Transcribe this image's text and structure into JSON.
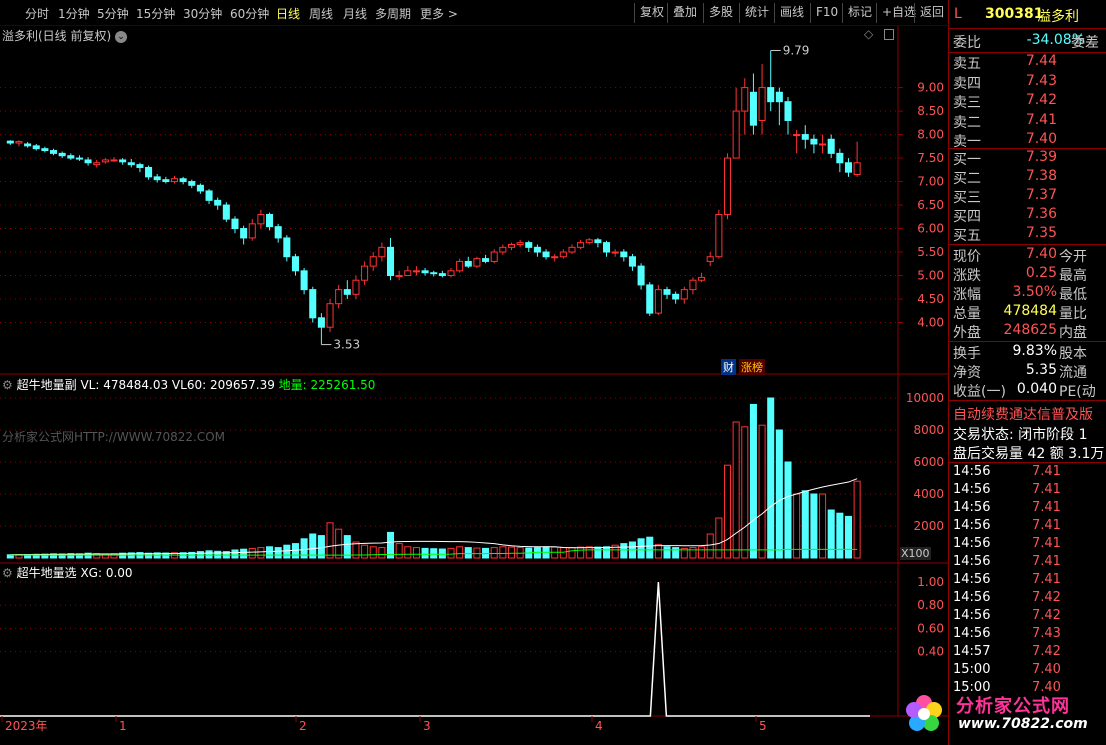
{
  "toolbar": {
    "periods": [
      "分时",
      "1分钟",
      "5分钟",
      "15分钟",
      "30分钟",
      "60分钟",
      "日线",
      "周线",
      "月线",
      "多周期",
      "更多 >"
    ],
    "active_period": "日线",
    "buttons": [
      "复权",
      "叠加",
      "多股",
      "统计",
      "画线",
      "F10",
      "标记",
      "+自选",
      "返回"
    ]
  },
  "main_pane": {
    "title": "溢多利(日线 前复权)",
    "high_label": "9.79",
    "low_label": "3.53",
    "badges": [
      "财",
      "涨榜"
    ]
  },
  "vol_pane": {
    "name": "超牛地量副",
    "vl": "VL: 478484.03",
    "vl60": "VL60: 209657.39",
    "diliang": "地量: 225261.50",
    "watermark": "分析家公式网HTTP://WWW.70822.COM",
    "unit": "X100"
  },
  "sig_pane": {
    "name": "超牛地量选",
    "xg": "XG: 0.00"
  },
  "xaxis": [
    "2023年",
    "1",
    "2",
    "3",
    "4",
    "5"
  ],
  "right_panel": {
    "header_code": "300381",
    "header_name": "溢多利",
    "header_L": "L",
    "weibi_label": "委比",
    "weibi_value": "-34.08%",
    "weibi_extra": "委差",
    "asks": [
      {
        "label": "卖五",
        "price": "7.44"
      },
      {
        "label": "卖四",
        "price": "7.43"
      },
      {
        "label": "卖三",
        "price": "7.42"
      },
      {
        "label": "卖二",
        "price": "7.41"
      },
      {
        "label": "卖一",
        "price": "7.40"
      }
    ],
    "bids": [
      {
        "label": "买一",
        "price": "7.39"
      },
      {
        "label": "买二",
        "price": "7.38"
      },
      {
        "label": "买三",
        "price": "7.37"
      },
      {
        "label": "买四",
        "price": "7.36"
      },
      {
        "label": "买五",
        "price": "7.35"
      }
    ],
    "quote": [
      {
        "label": "现价",
        "value": "7.40",
        "extra": "今开",
        "cls": "red"
      },
      {
        "label": "涨跌",
        "value": "0.25",
        "extra": "最高",
        "cls": "red"
      },
      {
        "label": "涨幅",
        "value": "3.50%",
        "extra": "最低",
        "cls": "red"
      },
      {
        "label": "总量",
        "value": "478484",
        "extra": "量比",
        "cls": "yellow"
      },
      {
        "label": "外盘",
        "value": "248625",
        "extra": "内盘",
        "cls": "red"
      }
    ],
    "stats": [
      {
        "label": "换手",
        "value": "9.83%",
        "extra": "股本"
      },
      {
        "label": "净资",
        "value": "5.35",
        "extra": "流通"
      },
      {
        "label": "收益(一)",
        "value": "0.040",
        "extra": "PE(动"
      }
    ],
    "notice": "自动续费通达信普及版",
    "trade_status": "交易状态: 闭市阶段 1",
    "after_hours": "盘后交易量 42 额 3.1万",
    "ticks": [
      {
        "time": "14:56",
        "price": "7.41"
      },
      {
        "time": "14:56",
        "price": "7.41"
      },
      {
        "time": "14:56",
        "price": "7.41"
      },
      {
        "time": "14:56",
        "price": "7.41"
      },
      {
        "time": "14:56",
        "price": "7.41"
      },
      {
        "time": "14:56",
        "price": "7.41"
      },
      {
        "time": "14:56",
        "price": "7.41"
      },
      {
        "time": "14:56",
        "price": "7.42"
      },
      {
        "time": "14:56",
        "price": "7.42"
      },
      {
        "time": "14:56",
        "price": "7.43"
      },
      {
        "time": "14:57",
        "price": "7.42"
      },
      {
        "time": "15:00",
        "price": "7.40"
      },
      {
        "time": "15:00",
        "price": "7.40"
      }
    ]
  },
  "logo": {
    "title": "分析家公式网",
    "url": "www.70822.com"
  },
  "colors": {
    "up": "#ff3232",
    "down": "#54ffff",
    "grid": "#8b0000",
    "ma": "#ffffff",
    "diliang": "#00ff00"
  },
  "chart_data": {
    "type": "candlestick",
    "price_axis": {
      "ticks": [
        "9.00",
        "8.50",
        "8.00",
        "7.50",
        "7.00",
        "6.50",
        "6.00",
        "5.50",
        "5.00",
        "4.50",
        "4.00"
      ],
      "range": [
        3.5,
        9.8
      ]
    },
    "candles": [
      [
        7.86,
        7.82,
        7.88,
        7.78
      ],
      [
        7.82,
        7.85,
        7.88,
        7.75
      ],
      [
        7.8,
        7.76,
        7.84,
        7.72
      ],
      [
        7.76,
        7.7,
        7.8,
        7.66
      ],
      [
        7.7,
        7.66,
        7.74,
        7.62
      ],
      [
        7.66,
        7.6,
        7.7,
        7.56
      ],
      [
        7.6,
        7.55,
        7.64,
        7.5
      ],
      [
        7.55,
        7.5,
        7.6,
        7.46
      ],
      [
        7.5,
        7.48,
        7.56,
        7.44
      ],
      [
        7.46,
        7.4,
        7.52,
        7.34
      ],
      [
        7.36,
        7.4,
        7.46,
        7.3
      ],
      [
        7.42,
        7.46,
        7.5,
        7.38
      ],
      [
        7.46,
        7.46,
        7.52,
        7.42
      ],
      [
        7.46,
        7.42,
        7.5,
        7.36
      ],
      [
        7.4,
        7.36,
        7.48,
        7.3
      ],
      [
        7.36,
        7.3,
        7.4,
        7.2
      ],
      [
        7.3,
        7.1,
        7.34,
        7.04
      ],
      [
        7.1,
        7.04,
        7.16,
        6.98
      ],
      [
        7.04,
        7.0,
        7.1,
        6.96
      ],
      [
        7.0,
        7.06,
        7.12,
        6.96
      ],
      [
        7.06,
        7.0,
        7.1,
        6.94
      ],
      [
        7.0,
        6.92,
        7.04,
        6.86
      ],
      [
        6.92,
        6.8,
        6.96,
        6.74
      ],
      [
        6.8,
        6.6,
        6.84,
        6.52
      ],
      [
        6.6,
        6.5,
        6.66,
        6.4
      ],
      [
        6.5,
        6.2,
        6.56,
        6.14
      ],
      [
        6.2,
        6.0,
        6.26,
        5.9
      ],
      [
        6.0,
        5.8,
        6.06,
        5.66
      ],
      [
        5.8,
        6.1,
        6.2,
        5.74
      ],
      [
        6.1,
        6.3,
        6.4,
        6.0
      ],
      [
        6.3,
        6.04,
        6.34,
        5.96
      ],
      [
        6.04,
        5.8,
        6.1,
        5.7
      ],
      [
        5.8,
        5.4,
        5.86,
        5.3
      ],
      [
        5.4,
        5.1,
        5.46,
        5.0
      ],
      [
        5.1,
        4.7,
        5.16,
        4.6
      ],
      [
        4.7,
        4.1,
        4.76,
        4.0
      ],
      [
        4.1,
        3.9,
        4.2,
        3.53
      ],
      [
        3.9,
        4.4,
        4.5,
        3.8
      ],
      [
        4.4,
        4.7,
        4.8,
        4.3
      ],
      [
        4.7,
        4.6,
        4.9,
        4.5
      ],
      [
        4.6,
        4.9,
        5.0,
        4.5
      ],
      [
        4.9,
        5.2,
        5.3,
        4.8
      ],
      [
        5.2,
        5.4,
        5.5,
        5.1
      ],
      [
        5.4,
        5.6,
        5.7,
        5.3
      ],
      [
        5.6,
        5.0,
        5.8,
        4.9
      ],
      [
        5.0,
        5.0,
        5.1,
        4.9
      ],
      [
        5.0,
        5.1,
        5.2,
        5.0
      ],
      [
        5.1,
        5.1,
        5.2,
        5.0
      ],
      [
        5.1,
        5.06,
        5.16,
        5.0
      ],
      [
        5.06,
        5.04,
        5.1,
        4.98
      ],
      [
        5.04,
        5.0,
        5.1,
        4.96
      ],
      [
        5.0,
        5.1,
        5.16,
        4.96
      ],
      [
        5.1,
        5.3,
        5.36,
        5.06
      ],
      [
        5.3,
        5.2,
        5.4,
        5.16
      ],
      [
        5.2,
        5.36,
        5.4,
        5.16
      ],
      [
        5.36,
        5.3,
        5.44,
        5.26
      ],
      [
        5.3,
        5.5,
        5.56,
        5.26
      ],
      [
        5.5,
        5.6,
        5.66,
        5.44
      ],
      [
        5.6,
        5.66,
        5.7,
        5.54
      ],
      [
        5.66,
        5.7,
        5.76,
        5.6
      ],
      [
        5.7,
        5.6,
        5.74,
        5.5
      ],
      [
        5.6,
        5.5,
        5.66,
        5.4
      ],
      [
        5.5,
        5.4,
        5.56,
        5.34
      ],
      [
        5.4,
        5.4,
        5.46,
        5.3
      ],
      [
        5.4,
        5.5,
        5.56,
        5.36
      ],
      [
        5.5,
        5.6,
        5.66,
        5.46
      ],
      [
        5.6,
        5.7,
        5.76,
        5.56
      ],
      [
        5.7,
        5.76,
        5.8,
        5.66
      ],
      [
        5.76,
        5.7,
        5.8,
        5.6
      ],
      [
        5.7,
        5.5,
        5.74,
        5.4
      ],
      [
        5.5,
        5.5,
        5.56,
        5.4
      ],
      [
        5.5,
        5.4,
        5.56,
        5.3
      ],
      [
        5.4,
        5.2,
        5.46,
        5.1
      ],
      [
        5.2,
        4.8,
        5.26,
        4.7
      ],
      [
        4.8,
        4.2,
        4.86,
        4.14
      ],
      [
        4.2,
        4.7,
        4.8,
        4.16
      ],
      [
        4.7,
        4.6,
        4.76,
        4.5
      ],
      [
        4.6,
        4.5,
        4.66,
        4.4
      ],
      [
        4.5,
        4.7,
        4.76,
        4.4
      ],
      [
        4.7,
        4.9,
        4.96,
        4.6
      ],
      [
        4.9,
        4.96,
        5.06,
        4.86
      ],
      [
        5.3,
        5.4,
        5.5,
        5.2
      ],
      [
        5.4,
        6.3,
        6.4,
        5.36
      ],
      [
        6.3,
        7.5,
        7.6,
        6.2
      ],
      [
        7.5,
        8.5,
        9.0,
        7.7
      ],
      [
        8.5,
        9.0,
        9.2,
        8.0
      ],
      [
        8.9,
        8.2,
        9.3,
        8.0
      ],
      [
        8.3,
        9.0,
        9.5,
        8.0
      ],
      [
        9.0,
        8.7,
        9.79,
        8.5
      ],
      [
        8.9,
        8.7,
        9.0,
        8.2
      ],
      [
        8.7,
        8.3,
        8.8,
        8.0
      ],
      [
        8.0,
        8.0,
        8.1,
        7.6
      ],
      [
        8.0,
        7.9,
        8.2,
        7.7
      ],
      [
        7.9,
        7.8,
        8.0,
        7.6
      ],
      [
        7.8,
        7.8,
        8.0,
        7.6
      ],
      [
        7.9,
        7.6,
        8.0,
        7.5
      ],
      [
        7.6,
        7.4,
        7.7,
        7.2
      ],
      [
        7.4,
        7.2,
        7.5,
        7.1
      ],
      [
        7.15,
        7.4,
        7.85,
        7.1
      ]
    ],
    "volume_axis": {
      "ticks": [
        "10000",
        "8000",
        "6000",
        "4000",
        "2000"
      ],
      "unit": "X100"
    },
    "volumes": [
      200,
      220,
      210,
      230,
      240,
      260,
      250,
      270,
      260,
      300,
      280,
      260,
      270,
      300,
      320,
      340,
      300,
      320,
      310,
      330,
      330,
      350,
      400,
      450,
      420,
      400,
      500,
      550,
      600,
      650,
      700,
      650,
      800,
      900,
      1200,
      1500,
      1400,
      2200,
      1800,
      1400,
      1000,
      800,
      700,
      650,
      1600,
      900,
      700,
      650,
      600,
      580,
      560,
      600,
      700,
      650,
      620,
      600,
      650,
      700,
      680,
      650,
      620,
      650,
      700,
      680,
      650,
      650,
      680,
      700,
      680,
      700,
      800,
      900,
      1000,
      1200,
      1300,
      850,
      700,
      650,
      600,
      650,
      700,
      1500,
      2500,
      5800,
      8500,
      8200,
      9600,
      8300,
      10000,
      8000,
      6000,
      4000,
      4200,
      4000,
      4000,
      3000,
      2800,
      2600,
      4800
    ],
    "signal_axis": {
      "ticks": [
        "1.00",
        "0.80",
        "0.60",
        "0.40"
      ]
    },
    "signal_spike_index": 75,
    "signal_value": 1.0
  }
}
